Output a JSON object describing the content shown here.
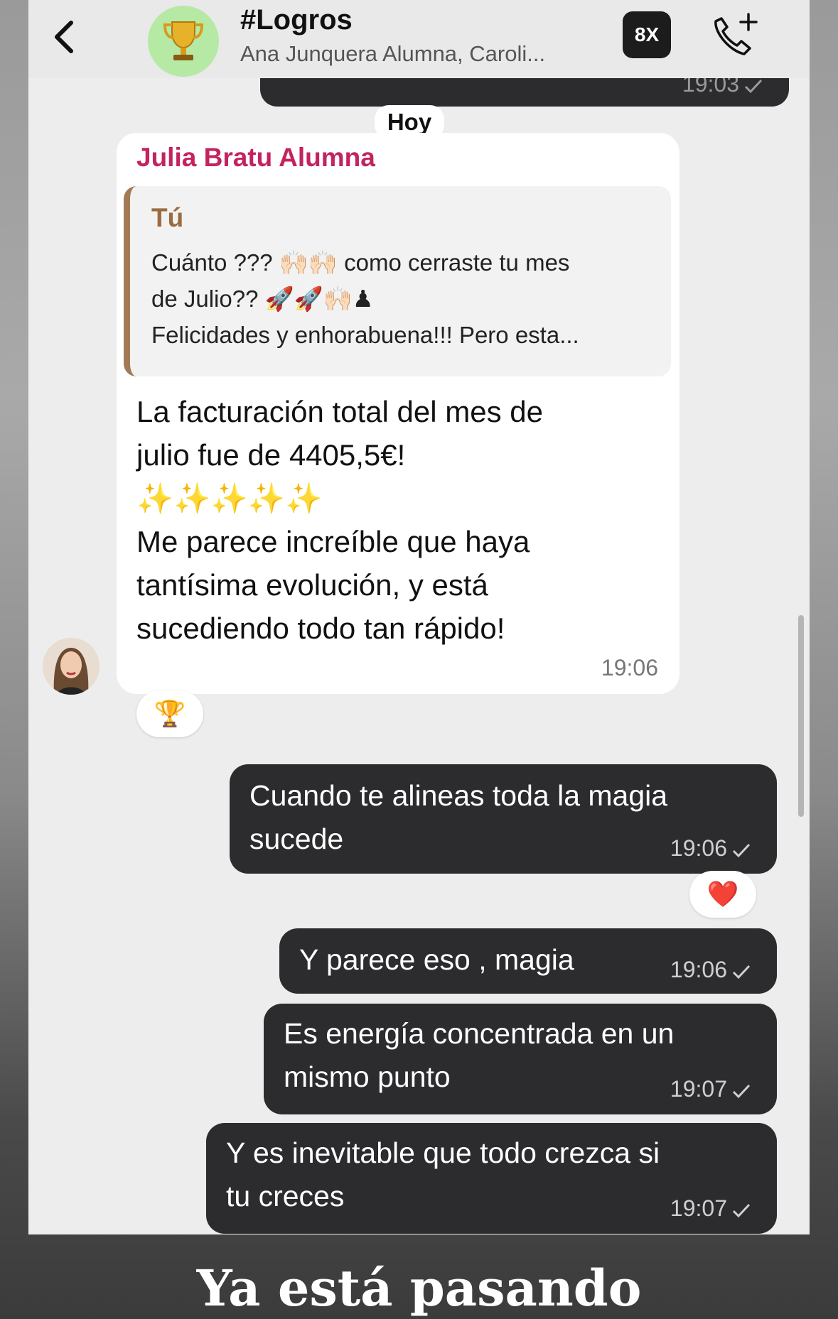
{
  "header": {
    "title": "#Logros",
    "subtitle": "Ana Junquera Alumna, Caroli...",
    "badge_label": "8X"
  },
  "messages": {
    "prev_time": "19:03",
    "day_label": "Hoy",
    "incoming": {
      "sender": "Julia Bratu Alumna",
      "quote_author": "Tú",
      "quote_line1": "Cuánto ??? 🙌🏻🙌🏻 como cerraste tu mes",
      "quote_line2": "de Julio?? 🚀🚀🙌🏻♟",
      "quote_line3": "Felicidades y enhorabuena!!! Pero esta...",
      "body_line1": "La facturación total del mes de",
      "body_line2": "julio fue de 4405,5€!",
      "body_line3": "✨✨✨✨✨",
      "body_line4": "Me parece increíble que haya",
      "body_line5": "tantísima evolución, y está",
      "body_line6": "sucediendo todo tan rápido!",
      "time": "19:06",
      "reaction": "🏆"
    },
    "outgoing": [
      {
        "line1": "Cuando te alineas toda la magia",
        "line2": "sucede",
        "time": "19:06",
        "reaction": "❤️"
      },
      {
        "line1": "Y parece eso , magia",
        "time": "19:06"
      },
      {
        "line1": "Es energía concentrada en un",
        "line2": "mismo punto",
        "time": "19:07"
      },
      {
        "line1": "Y es inevitable que todo crezca si",
        "line2": "tu creces",
        "time": "19:07"
      }
    ]
  },
  "caption": "Ya está pasando",
  "colors": {
    "sender_name": "#c3235f",
    "quote_bar": "#a27b55",
    "outgoing_bubble": "#2c2c2e",
    "group_avatar_bg": "#b6eaa4"
  }
}
